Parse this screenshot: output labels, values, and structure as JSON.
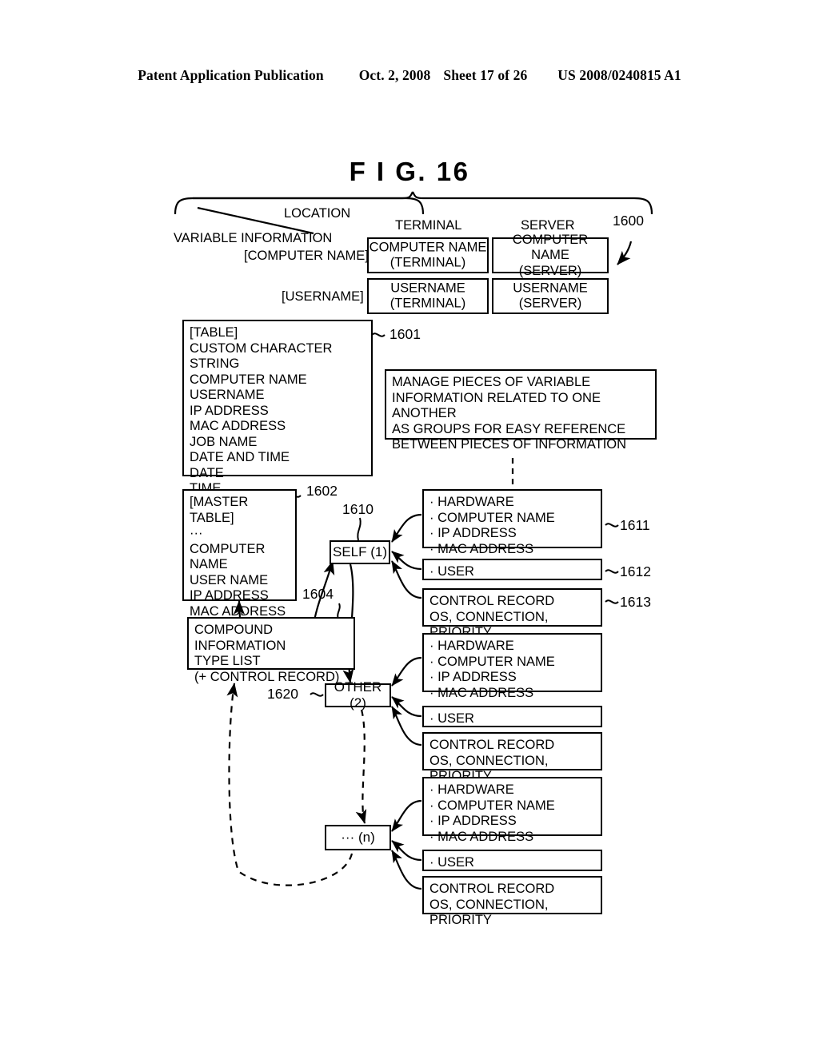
{
  "header": {
    "publication": "Patent Application Publication",
    "date": "Oct. 2, 2008",
    "sheet": "Sheet 17 of 26",
    "patent_number": "US 2008/0240815 A1"
  },
  "figure": {
    "title": "F I G.  16"
  },
  "matrix": {
    "axis_row_label": "LOCATION",
    "axis_col_label": "VARIABLE INFORMATION",
    "ref": "1600",
    "columns": [
      "TERMINAL",
      "SERVER"
    ],
    "rows": [
      {
        "label": "[COMPUTER NAME]",
        "cells": [
          {
            "line1": "COMPUTER NAME",
            "line2": "(TERMINAL)"
          },
          {
            "line1": "COMPUTER NAME",
            "line2": "(SERVER)"
          }
        ]
      },
      {
        "label": "[USERNAME]",
        "cells": [
          {
            "line1": "USERNAME",
            "line2": "(TERMINAL)"
          },
          {
            "line1": "USERNAME",
            "line2": "(SERVER)"
          }
        ]
      }
    ]
  },
  "table_box": {
    "ref": "1601",
    "lines": [
      "[TABLE]",
      "CUSTOM CHARACTER STRING",
      "COMPUTER NAME",
      "USERNAME",
      "IP ADDRESS",
      "MAC ADDRESS",
      "JOB NAME",
      "DATE AND TIME",
      "DATE",
      "TIME"
    ]
  },
  "note_box": {
    "lines": [
      "MANAGE PIECES OF VARIABLE",
      "INFORMATION RELATED TO ONE ANOTHER",
      "AS GROUPS FOR EASY REFERENCE",
      "BETWEEN PIECES OF INFORMATION"
    ]
  },
  "master_table_box": {
    "ref": "1602",
    "lines": [
      "[MASTER TABLE]",
      "···",
      "COMPUTER NAME",
      "USER NAME",
      "IP ADDRESS",
      "MAC ADDRESS",
      "···"
    ]
  },
  "compound_box": {
    "ref": "1604",
    "lines": [
      "COMPOUND INFORMATION",
      "TYPE LIST",
      "(+ CONTROL RECORD)"
    ]
  },
  "nodes": [
    {
      "label": "SELF (1)",
      "ref": "1610"
    },
    {
      "label": "OTHER (2)",
      "ref": "1620"
    },
    {
      "label": "··· (n)",
      "ref": ""
    }
  ],
  "groups": [
    {
      "hardware": {
        "ref": "1611",
        "lines": [
          "· HARDWARE",
          "  · COMPUTER NAME",
          "  · IP ADDRESS",
          "  · MAC ADDRESS"
        ]
      },
      "user": {
        "ref": "1612",
        "lines": [
          "· USER"
        ]
      },
      "control": {
        "ref": "1613",
        "lines": [
          "CONTROL RECORD",
          "OS, CONNECTION, PRIORITY"
        ]
      }
    },
    {
      "hardware": {
        "ref": "",
        "lines": [
          "· HARDWARE",
          "  · COMPUTER NAME",
          "  · IP ADDRESS",
          "  · MAC ADDRESS"
        ]
      },
      "user": {
        "ref": "",
        "lines": [
          "· USER"
        ]
      },
      "control": {
        "ref": "",
        "lines": [
          "CONTROL RECORD",
          "OS, CONNECTION, PRIORITY"
        ]
      }
    },
    {
      "hardware": {
        "ref": "",
        "lines": [
          "· HARDWARE",
          "  · COMPUTER NAME",
          "  · IP ADDRESS",
          "  · MAC ADDRESS"
        ]
      },
      "user": {
        "ref": "",
        "lines": [
          "· USER"
        ]
      },
      "control": {
        "ref": "",
        "lines": [
          "CONTROL RECORD",
          "OS, CONNECTION, PRIORITY"
        ]
      }
    }
  ]
}
